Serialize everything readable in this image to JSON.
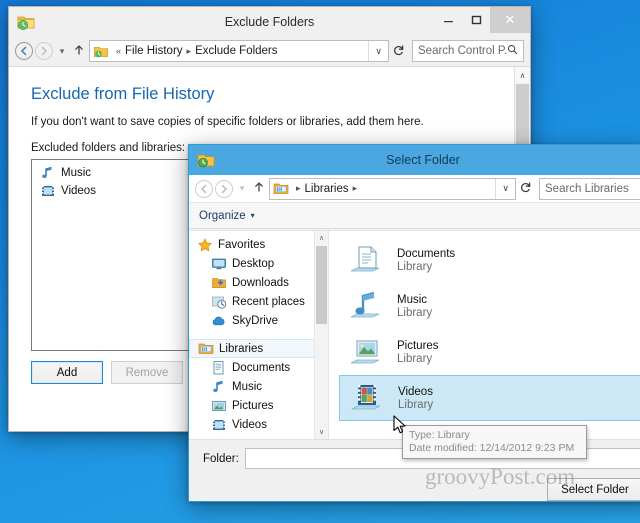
{
  "desktop": {
    "bg_color": "#1b8fe0"
  },
  "exclude_window": {
    "title": "Exclude Folders",
    "icon": "file-history-icon",
    "window_buttons": {
      "minimize": "–",
      "maximize": "❐",
      "close": "✕"
    },
    "address_bar": {
      "back": "←",
      "forward": "→",
      "history_dropdown": "▾",
      "up": "↑",
      "crumb_icon": "file-history-icon",
      "chevrons": "«",
      "crumbs": [
        "File History",
        "Exclude Folders"
      ],
      "separator": "▸",
      "dropdown": "∨",
      "refresh": "↻",
      "search_placeholder": "Search Control P...",
      "search_value": "",
      "search_icon": "🔍"
    },
    "page": {
      "heading": "Exclude from File History",
      "description": "If you don't want to save copies of specific folders or libraries, add them here.",
      "list_label": "Excluded folders and libraries:",
      "excluded_items": [
        {
          "label": "Music",
          "icon": "music-icon"
        },
        {
          "label": "Videos",
          "icon": "video-icon"
        }
      ],
      "buttons": {
        "add": "Add",
        "remove": "Remove"
      }
    },
    "scrollbar": {
      "up_arrow": "∧",
      "down_arrow": "∨"
    }
  },
  "select_folder_dialog": {
    "title": "Select Folder",
    "icon": "folder-history-icon",
    "address_bar": {
      "back": "←",
      "forward": "→",
      "history_dropdown": "▾",
      "up": "↑",
      "crumb_icon": "libraries-icon",
      "separator": "▸",
      "crumbs": [
        "Libraries"
      ],
      "dropdown": "∨",
      "refresh": "↻",
      "search_placeholder": "Search Libraries",
      "search_value": ""
    },
    "toolbar": {
      "organize": "Organize",
      "organize_caret": "▾"
    },
    "nav_pane": {
      "groups": [
        {
          "label": "Favorites",
          "icon": "star-icon",
          "children": [
            {
              "label": "Desktop",
              "icon": "desktop-icon"
            },
            {
              "label": "Downloads",
              "icon": "downloads-icon"
            },
            {
              "label": "Recent places",
              "icon": "recent-places-icon"
            },
            {
              "label": "SkyDrive",
              "icon": "skydrive-icon"
            }
          ]
        },
        {
          "label": "Libraries",
          "icon": "libraries-icon",
          "selected": true,
          "children": [
            {
              "label": "Documents",
              "icon": "documents-icon"
            },
            {
              "label": "Music",
              "icon": "music-icon"
            },
            {
              "label": "Pictures",
              "icon": "pictures-icon"
            },
            {
              "label": "Videos",
              "icon": "video-icon"
            }
          ]
        }
      ],
      "scroll_up": "∧",
      "scroll_down": "∨"
    },
    "file_pane": {
      "items": [
        {
          "name": "Documents",
          "subtitle": "Library",
          "icon": "documents-library-icon",
          "selected": false
        },
        {
          "name": "Music",
          "subtitle": "Library",
          "icon": "music-library-icon",
          "selected": false
        },
        {
          "name": "Pictures",
          "subtitle": "Library",
          "icon": "pictures-library-icon",
          "selected": false
        },
        {
          "name": "Videos",
          "subtitle": "Library",
          "icon": "videos-library-icon",
          "selected": true
        }
      ],
      "scroll_up": "∧",
      "scroll_down": "∨"
    },
    "footer": {
      "folder_label": "Folder:",
      "folder_value": "",
      "select_button": "Select Folder"
    }
  },
  "tooltip": {
    "type_line": "Type: Library",
    "date_line": "Date modified: 12/14/2012 9:23 PM"
  },
  "watermark": {
    "text": "groovyPost.com"
  }
}
